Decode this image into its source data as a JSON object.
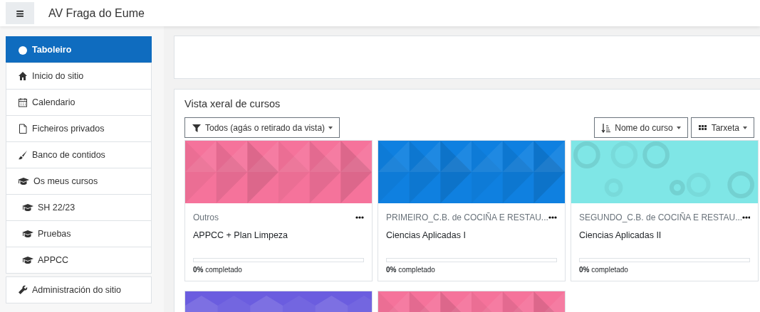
{
  "navbar": {
    "menu_glyph": "≡",
    "site_name": "AV Fraga do Eume"
  },
  "sidebar": {
    "groups": [
      {
        "items": [
          {
            "label": "Taboleiro",
            "selected": true
          },
          {
            "label": "Inicio do sitio",
            "selected": false
          },
          {
            "label": "Calendario",
            "selected": false
          },
          {
            "label": "Ficheiros privados",
            "selected": false
          },
          {
            "label": "Banco de contidos",
            "selected": false
          },
          {
            "label": "Os meus cursos",
            "selected": false,
            "children": [
              {
                "label": "SH 22/23",
                "selected": false
              },
              {
                "label": "Pruebas",
                "selected": false
              },
              {
                "label": "APPCC",
                "selected": false
              }
            ]
          }
        ]
      },
      {
        "items": [
          {
            "label": "Administración do sitio",
            "selected": false
          }
        ]
      }
    ]
  },
  "course_overview": {
    "title": "Vista xeral de cursos",
    "filter": {
      "label": "Todos (agás o retirado da vista)"
    },
    "sort": {
      "label": "Nome do curso"
    },
    "view": {
      "label": "Tarxeta"
    },
    "courses": [
      {
        "color": "#f5739b",
        "category": "Outros",
        "name": "APPCC + Plan Limpeza",
        "level": 0,
        "progress_text": "**0%** completado"
      },
      {
        "color": "#0f80e0",
        "category": "PRIMEIRO_C.B. de COCIÑA E RESTAU...",
        "name": "Ciencias Aplicadas I",
        "level": 0,
        "progress_text": "**0%** completado"
      },
      {
        "color": "#7fe6e6",
        "category": "SEGUNDO_C.B. de COCIÑA E RESTAU...",
        "name": "Ciencias Aplicadas II",
        "level": 0,
        "progress_text": "**0%** completado"
      },
      {
        "color": "#6b5ddf"
      },
      {
        "color": "#f5739b"
      }
    ]
  }
}
